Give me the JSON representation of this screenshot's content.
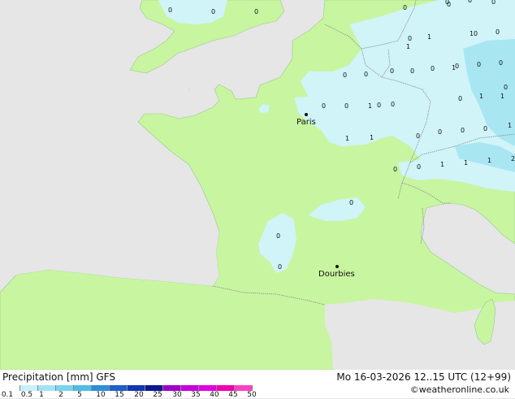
{
  "map": {
    "cities": [
      {
        "name": "Paris"
      },
      {
        "name": "Dourbies"
      }
    ],
    "values": [
      "0",
      "0",
      "0",
      "0",
      "0",
      "0",
      "0",
      "0",
      "1",
      "1",
      "0",
      "0",
      "0",
      "0",
      "0",
      "0",
      "0",
      "0",
      "0",
      "0",
      "1",
      "1",
      "0",
      "0",
      "1",
      "0",
      "0",
      "0",
      "0",
      "1",
      "1",
      "1",
      "0",
      "0",
      "0",
      "1",
      "1",
      "1",
      "2",
      "0",
      "0",
      "0",
      "1",
      "1",
      "0",
      "0",
      "0",
      "0"
    ]
  },
  "footer": {
    "title": "Precipitation [mm]  GFS",
    "datetime": "Mo 16-03-2026 12..15 UTC (12+99)",
    "copyright": "©weatheronline.co.uk"
  },
  "legend": {
    "ticks": [
      "0.1",
      "0.5",
      "1",
      "2",
      "5",
      "10",
      "15",
      "20",
      "25",
      "30",
      "35",
      "40",
      "45",
      "50"
    ],
    "colors": [
      "#ffffff",
      "#c8f0f8",
      "#a0e4f4",
      "#78d4ee",
      "#50bde6",
      "#2b8fd8",
      "#1f5fc8",
      "#1238b0",
      "#0a1a90",
      "#a000c8",
      "#c800d8",
      "#e000e0",
      "#f000b0",
      "#ff40c0"
    ]
  },
  "colors": {
    "land": "#c8f5a0",
    "sea": "#e6e6e6",
    "precip_light": "#d0f4f8",
    "precip_mid": "#a8e6f2",
    "border": "#a0a0a0"
  }
}
